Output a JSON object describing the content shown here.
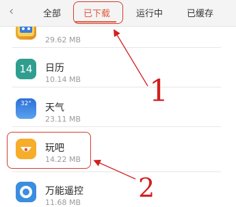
{
  "header": {
    "back_icon": "chevron-left-icon",
    "back_glyph": "‹",
    "tabs": [
      {
        "label": "全部",
        "active": false
      },
      {
        "label": "已下载",
        "active": true
      },
      {
        "label": "运行中",
        "active": false
      },
      {
        "label": "已缓存",
        "active": false
      }
    ],
    "accent_color": "#e2573b"
  },
  "apps": [
    {
      "name": "",
      "size": "29.62 MB",
      "icon": "game-app-icon"
    },
    {
      "name": "日历",
      "size": "10.14 MB",
      "icon": "calendar-icon",
      "icon_text": "14"
    },
    {
      "name": "天气",
      "size": "23.11 MB",
      "icon": "weather-icon",
      "icon_text": "32°"
    },
    {
      "name": "玩吧",
      "size": "14.22 MB",
      "icon": "wanba-app-icon"
    },
    {
      "name": "万能遥控",
      "size": "11.68 MB",
      "icon": "remote-control-icon"
    }
  ],
  "annotations": {
    "label_1": "1",
    "label_2": "2",
    "color": "#d21f1f"
  }
}
